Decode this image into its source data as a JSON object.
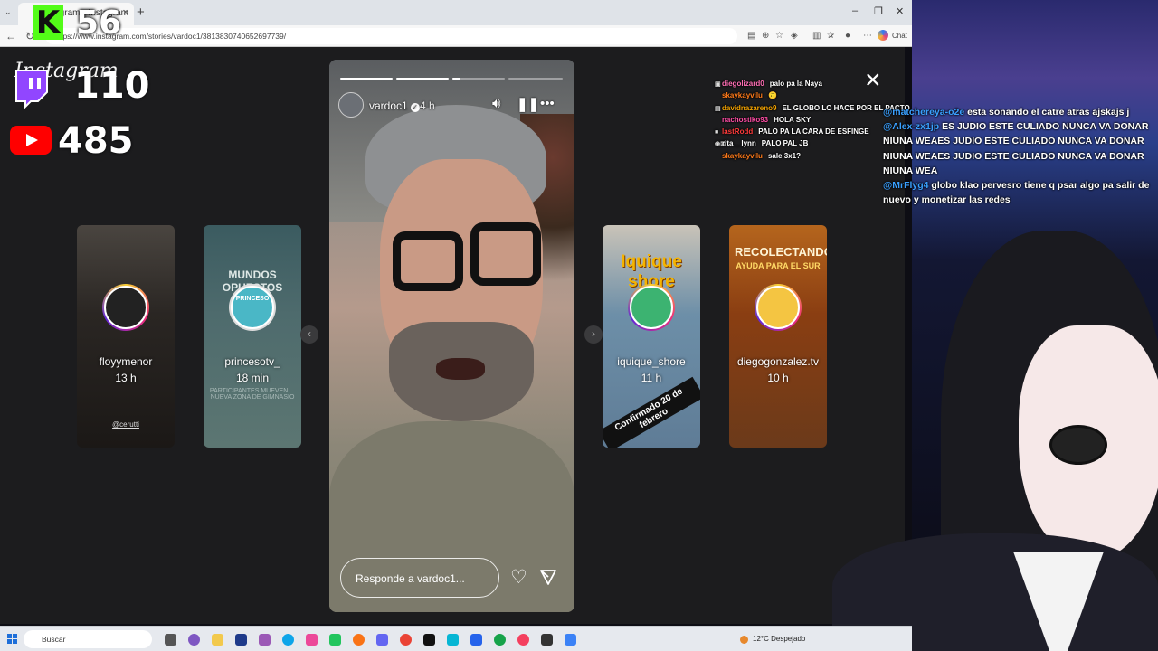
{
  "browser": {
    "tab_title": "Instagram • Instagram",
    "tab_close": "×",
    "new_tab": "+",
    "url": "https://www.instagram.com/stories/vardoc1/3813830740652697739/",
    "copilot_label": "Chat",
    "window_controls": {
      "minimize": "–",
      "restore": "❐",
      "close": "✕"
    }
  },
  "instagram": {
    "logo": "Instagram",
    "close": "×"
  },
  "stream_overlay": {
    "kick_letter": "K",
    "kick_viewers": "56",
    "twitch_viewers": "110",
    "youtube_viewers": "485"
  },
  "stories_left": [
    {
      "username": "floyymenor",
      "time": "13 h",
      "tag": "@cerutti"
    },
    {
      "username": "princesotv_",
      "time": "18 min",
      "headline": "MUNDOS OPUESTOS",
      "badge": "PRINCESO",
      "body": "PARTICIPANTES MUEVEN ... NUEVA ZONA DE GIMNASIO"
    }
  ],
  "stories_right": [
    {
      "username": "iquique_shore",
      "time": "11 h",
      "headline": "Iquique shore",
      "banner": "Confirmado 20 de febrero"
    },
    {
      "username": "diegogonzalez.tv",
      "time": "10 h",
      "headline": "RECOLECTANDO",
      "subheadline": "AYUDA PARA EL SUR"
    }
  ],
  "story": {
    "username": "vardoc1",
    "time": "4 h",
    "reply_placeholder": "Responde a vardoc1...",
    "progress": [
      1,
      1,
      0.15,
      0
    ]
  },
  "chat": [
    {
      "user": "diegolizard0",
      "color": "#ff6fb5",
      "text": "palo pa la Naya",
      "badge": "▣"
    },
    {
      "user": "skaykayvilu",
      "color": "#ff7a1a",
      "text": "🙃",
      "badge": ""
    },
    {
      "user": "davidnazareno9",
      "color": "#f4a300",
      "text": "EL GLOBO LO HACE POR EL PACTO",
      "badge": "▤"
    },
    {
      "user": "nachostiko93",
      "color": "#ff4da6",
      "text": "HOLA SKY",
      "badge": ""
    },
    {
      "user": "lastRodd",
      "color": "#ff3b3b",
      "text": "PALO PA LA CARA DE ESFINGE",
      "badge": "■"
    },
    {
      "user": "rita__lynn",
      "color": "#ffffff",
      "text": "PALO PAL JB",
      "badge": "◉⊠"
    },
    {
      "user": "skaykayvilu",
      "color": "#ff7a1a",
      "text": "sale 3x1?",
      "badge": ""
    }
  ],
  "side_chat": [
    {
      "mention": "@matchereya-o2e",
      "text": "esta sonando el catre atras ajskajs j"
    },
    {
      "mention": "@Alex-zx1jp",
      "text": "ES JUDIO ESTE CULIADO NUNCA VA DONAR NIUNA WEAES JUDIO ESTE CULIADO NUNCA VA DONAR NIUNA WEAES JUDIO ESTE CULIADO NUNCA VA DONAR NIUNA WEA"
    },
    {
      "mention": "@MrFlyg4",
      "text": "globo klao pervesro tiene q psar algo pa salir de nuevo y monetizar las redes"
    }
  ],
  "taskbar": {
    "search_placeholder": "Buscar",
    "weather": "12°C  Despejado"
  },
  "colors": {
    "kick_green": "#53fc18",
    "twitch_purple": "#9146ff",
    "youtube_red": "#ff0000",
    "ig_gradient": [
      "#f9ce34",
      "#ee2a7b",
      "#6228d7"
    ]
  }
}
